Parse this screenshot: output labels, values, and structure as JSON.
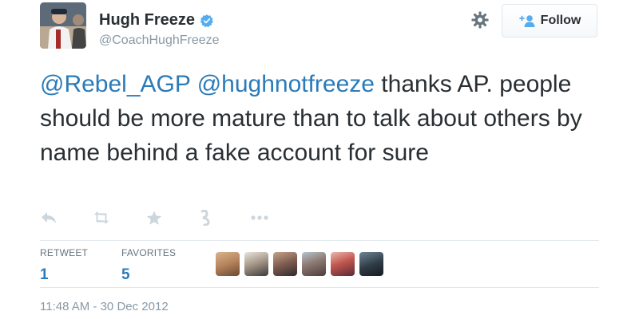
{
  "user": {
    "name": "Hugh Freeze",
    "handle": "@CoachHughFreeze",
    "verified": true
  },
  "header": {
    "follow_label": "Follow",
    "settings_icon": "gear-icon",
    "follow_icon": "add-user-icon"
  },
  "tweet": {
    "mention_1": "@Rebel_AGP",
    "mention_2": "@hughnotfreeze",
    "body": " thanks AP. people should be more mature than to talk about others by name behind a fake account for sure",
    "timestamp": "11:48 AM - 30 Dec 2012"
  },
  "actions": [
    {
      "icon": "reply-icon"
    },
    {
      "icon": "retweet-icon"
    },
    {
      "icon": "star-icon"
    },
    {
      "icon": "vine-icon"
    },
    {
      "icon": "more-icon"
    }
  ],
  "stats": {
    "retweet_label": "RETWEET",
    "retweet_count": "1",
    "favorites_label": "FAVORITES",
    "favorites_count": "5"
  },
  "favoriter_avatars": 6,
  "colors": {
    "link": "#2b7bb9",
    "verified": "#55acee",
    "muted": "#8899a6",
    "divider": "#e1e8ed",
    "action_icon": "#ccd6dd"
  }
}
